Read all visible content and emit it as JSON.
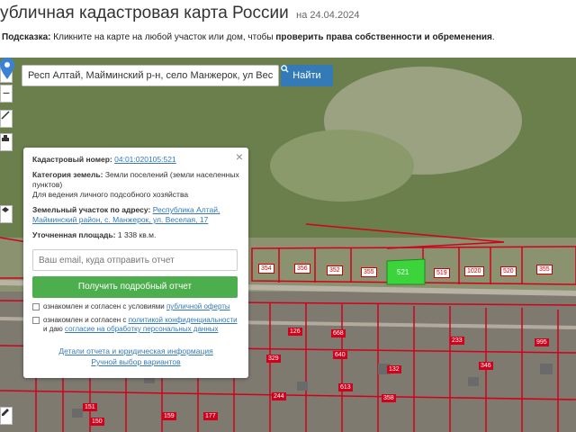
{
  "header": {
    "title": "убличная кадастровая карта России",
    "date": "на 24.04.2024",
    "hint_label": "Подсказка:",
    "hint_text": " Кликните на карте на любой участок или дом, чтобы ",
    "hint_bold": "проверить права собственности и обременения",
    "hint_end": "."
  },
  "search": {
    "value": "Респ Алтай, Майминский р-н, село Манжерок, ул Веселая,",
    "button_label": "Найти"
  },
  "controls": {
    "zoom_in": "+",
    "zoom_out": "−"
  },
  "panel": {
    "cadastral_label": "Кадастровый номер:",
    "cadastral_value": "04:01:020105:521",
    "category_label": "Категория земель:",
    "category_value": "Земли поселений (земли населенных пунктов)",
    "usage_value": "Для ведения личного подсобного хозяйства",
    "address_label": "Земельный участок по адресу:",
    "address_value": "Республика Алтай, Майминский район, с. Манжерок, ул. Веселая, 17",
    "area_label": "Уточненная площадь:",
    "area_value": "1 338 кв.м.",
    "email_placeholder": "Ваш email, куда отправить отчет",
    "report_button": "Получить подробный отчет",
    "consent1_text": "ознакомлен и согласен с условиями ",
    "consent1_link": "публичной оферты",
    "consent2_text": "ознакомлен и согласен с ",
    "consent2_link1": "политикой конфиденциальности",
    "consent2_mid": " и даю ",
    "consent2_link2": "согласие на обработку персональных данных",
    "details_link": "Детали отчета и юридическая информация",
    "manual_link": "Ручной выбор вариантов"
  },
  "map": {
    "target_parcel": "521",
    "parcel_labels": [
      "354",
      "356",
      "352",
      "355",
      "519",
      "1020",
      "520",
      "355",
      "915",
      "916",
      "109",
      "126",
      "668",
      "915",
      "117",
      "329",
      "640",
      "613",
      "132",
      "233",
      "346",
      "995",
      "244",
      "151",
      "358",
      "159",
      "150",
      "177"
    ]
  },
  "colors": {
    "accent": "#337ab7",
    "report": "#4cae4c",
    "parcel": "#d0021b",
    "selected": "#3bd43b"
  }
}
